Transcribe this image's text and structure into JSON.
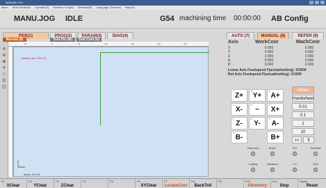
{
  "window": {
    "title": "NcStudio V10",
    "controls": [
      "_",
      "□",
      "×"
    ]
  },
  "menu": [
    "Mach",
    "Work Mode(M)",
    "Operate(O)",
    "Machine Tool(M)",
    "Window(W)",
    "Language (Ganesh)",
    "Help(H)"
  ],
  "status": {
    "mode": "MANU.JOG",
    "state": "IDLE",
    "gcode": "G54",
    "machining_label": "machining time",
    "time": "00:00:00",
    "config": "AB Config"
  },
  "tabs_left": [
    "POS(1)",
    "PROG(2)",
    "PARAM(3)",
    "DIAG(4)"
  ],
  "subtabs_left": [
    "Normal (8)",
    "Tool Vis (W)",
    "Tool Com (E)"
  ],
  "tabs_right": [
    "AUTO (7)",
    "MANUAL (8)",
    "REFER (9)"
  ],
  "ruler_labels": [
    "-50",
    "0",
    "50",
    "100",
    "150",
    "200",
    "250"
  ],
  "canvas": {
    "info": "Visitation rate:  100*0.00",
    "memo": "Memo: 3V:1/3H"
  },
  "coords": {
    "header": [
      "Axis",
      "WorkCoor",
      "MachCoor"
    ],
    "rows": [
      {
        "axis": "X",
        "work": "0.000",
        "mach": "0.000"
      },
      {
        "axis": "Y",
        "work": "0.000",
        "mach": "0.000"
      },
      {
        "axis": "Z",
        "work": "0.000",
        "mach": "0.000"
      },
      {
        "axis": "A",
        "work": "0.000",
        "mach": "0.000"
      },
      {
        "axis": "B",
        "work": "0.000",
        "mach": "0.000"
      }
    ]
  },
  "feed": {
    "linear_label": "Linear Axis Feedspeed F(actual/setting): 0/3000",
    "rot_label": "Rot Axis Feedspeed F(actual/setting): 0/1000"
  },
  "jog": [
    {
      "num": "7",
      "label": "Z+"
    },
    {
      "num": "8",
      "label": "Y+"
    },
    {
      "num": "9",
      "label": "A+"
    },
    {
      "num": "4",
      "label": "X-"
    },
    {
      "num": "5",
      "label": "~"
    },
    {
      "num": "6",
      "label": "X+"
    },
    {
      "num": "1",
      "label": "Z-"
    },
    {
      "num": "2",
      "label": "Y-"
    },
    {
      "num": "3",
      "label": "A-"
    },
    {
      "num": "0",
      "label": "B-"
    },
    {
      "num": ".",
      "label": "B+"
    }
  ],
  "steps": {
    "active": "Serius",
    "items": [
      "Handwheel",
      "0.01",
      "0.1",
      "1",
      "10"
    ],
    "more": ">>",
    "more_val": "5"
  },
  "tools": [
    {
      "label": "Removal",
      "icon": "⚙"
    },
    {
      "label": "Motor",
      "icon": "⚙"
    },
    {
      "label": "H.P",
      "icon": "⚙"
    },
    {
      "label": "Simulate",
      "icon": "⚙"
    },
    {
      "label": "Cutting",
      "icon": "⚙"
    },
    {
      "label": "Abrasion",
      "icon": "⚙"
    },
    {
      "label": "L.P",
      "icon": "⚙"
    },
    {
      "label": "Drill",
      "icon": "⚙"
    }
  ],
  "fkeys": [
    {
      "key": "F1",
      "label": "XClear"
    },
    {
      "key": "F2",
      "label": "YClear"
    },
    {
      "key": "F3",
      "label": "ZClear"
    },
    {
      "key": "F4",
      "label": ""
    },
    {
      "key": "F5",
      "label": ""
    },
    {
      "key": "F6",
      "label": "XYClear"
    },
    {
      "key": "F7",
      "label": "LocateCoor",
      "orange": true
    },
    {
      "key": "F8",
      "label": "BackToll"
    },
    {
      "key": "F9",
      "label": ""
    },
    {
      "key": "F10",
      "label": "AlIreentry",
      "orange": true
    },
    {
      "key": "F11",
      "label": "Stop"
    },
    {
      "key": "Pause",
      "label": "Reset"
    }
  ],
  "colors": {
    "accent": "#c45a1a",
    "axis_line": "#3a9c3a",
    "canvas_bg": "#cfe2f5",
    "title_bar": "#3d5b8f"
  }
}
